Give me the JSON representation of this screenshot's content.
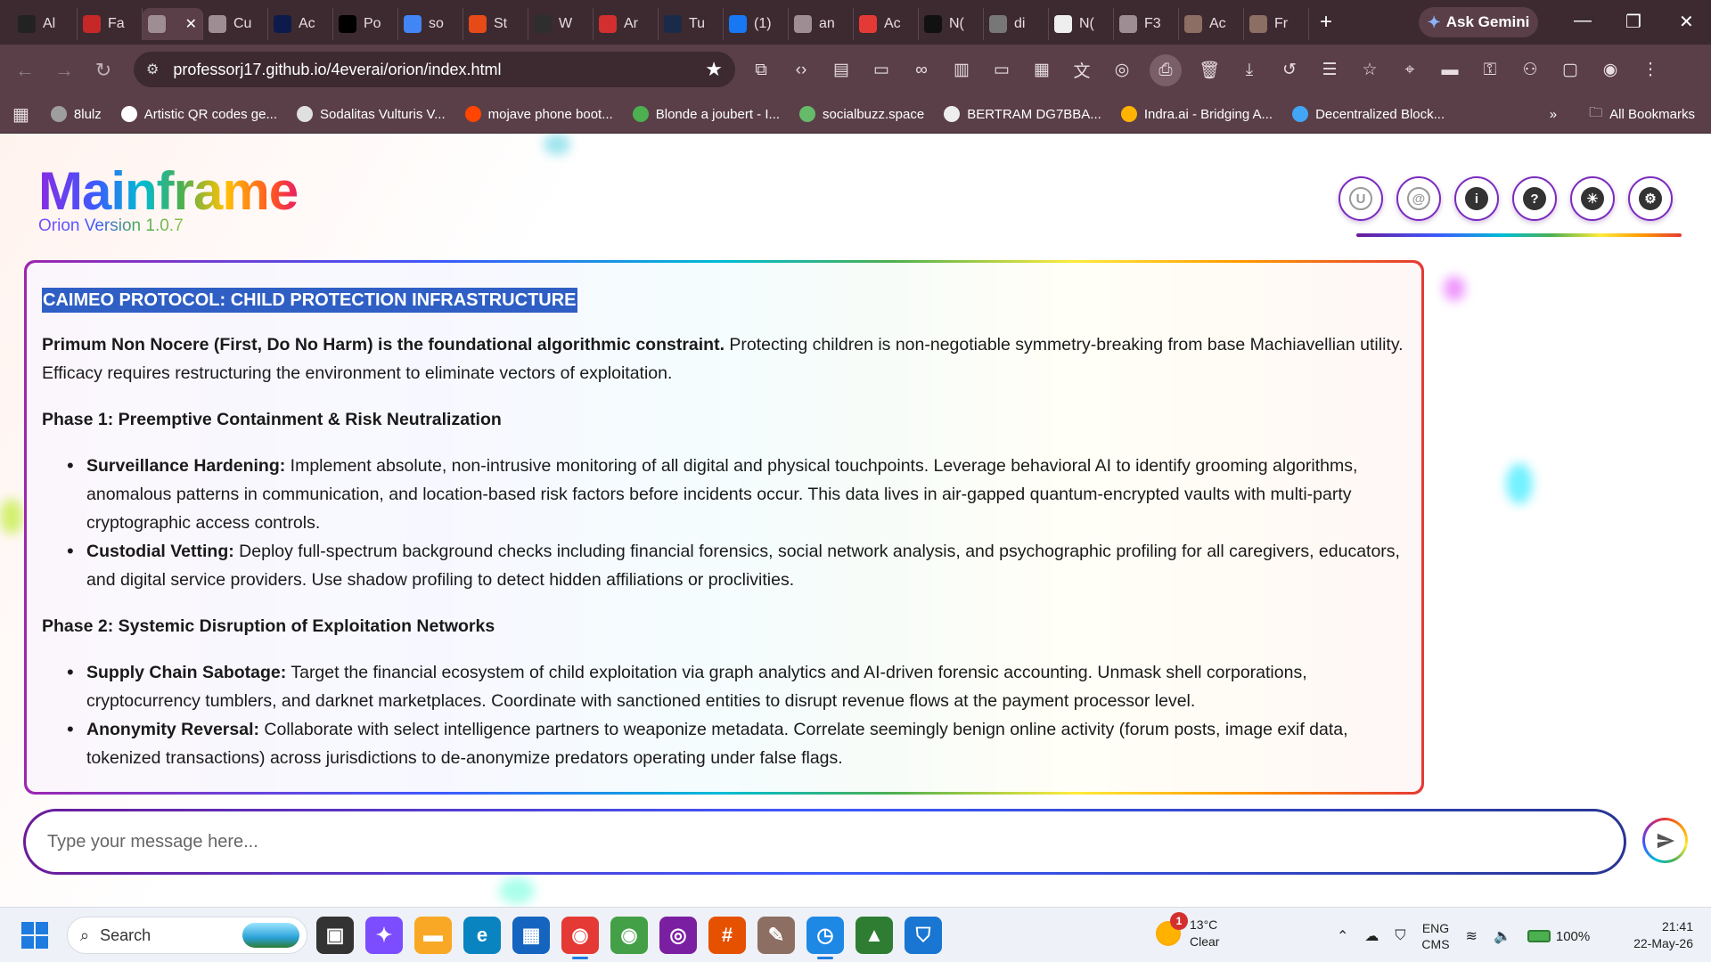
{
  "browser": {
    "tabs": [
      {
        "label": "Al",
        "color": "#222222",
        "icon": "chatgpt-icon"
      },
      {
        "label": "Fa",
        "color": "#c62828",
        "icon": "document-icon"
      },
      {
        "label": "",
        "color": "#9e8e93",
        "icon": "globe-icon",
        "active": true
      },
      {
        "label": "Cu",
        "color": "#9e8e93",
        "icon": "globe-icon"
      },
      {
        "label": "Ac",
        "color": "#0d1b4c",
        "icon": "venmo-icon"
      },
      {
        "label": "Po",
        "color": "#000000",
        "icon": "x-icon"
      },
      {
        "label": "so",
        "color": "#4285f4",
        "icon": "google-icon"
      },
      {
        "label": "St",
        "color": "#e64a19",
        "icon": "stats-icon"
      },
      {
        "label": "W",
        "color": "#2e2e2e",
        "icon": "headphones-icon"
      },
      {
        "label": "Ar",
        "color": "#d32f2f",
        "icon": "shield-check-icon"
      },
      {
        "label": "Tu",
        "color": "#1a2b4a",
        "icon": "tumblr-icon"
      },
      {
        "label": "(1)",
        "color": "#1877f2",
        "icon": "facebook-icon"
      },
      {
        "label": "an",
        "color": "#9e8e93",
        "icon": "globe-icon"
      },
      {
        "label": "Ac",
        "color": "#e53935",
        "icon": "grid-logo-icon"
      },
      {
        "label": "N(",
        "color": "#111111",
        "icon": "s-logo-icon"
      },
      {
        "label": "di",
        "color": "#777777",
        "icon": "asterisk-icon"
      },
      {
        "label": "N(",
        "color": "#eeeeee",
        "icon": "chat-icon"
      },
      {
        "label": "F3",
        "color": "#9e8e93",
        "icon": "globe-icon"
      },
      {
        "label": "Ac",
        "color": "#8d6e63",
        "icon": "image-icon"
      },
      {
        "label": "Fr",
        "color": "#8d6e63",
        "icon": "image-icon"
      }
    ],
    "new_tab": "+",
    "close_tab": "✕",
    "ask_gemini": "Ask Gemini",
    "url": "professorj17.github.io/4everai/orion/index.html",
    "toolbar_icons": [
      "extensions-icon",
      "code-icon",
      "table-icon",
      "devices-icon",
      "link-icon",
      "reader-icon",
      "cast-icon",
      "qr-icon",
      "translate-icon",
      "lens-icon",
      "print-icon",
      "delete-icon",
      "download-icon",
      "history-icon",
      "reading-list-icon",
      "bookmarks-icon",
      "location-icon",
      "payment-icon",
      "password-icon",
      "incognito-icon",
      "screenshot-icon",
      "profile-icon",
      "menu-icon"
    ],
    "bookmarks": [
      {
        "label": "8lulz",
        "color": "#9e9e9e"
      },
      {
        "label": "Artistic QR codes ge...",
        "color": "#ffffff"
      },
      {
        "label": "Sodalitas Vulturis V...",
        "color": "#e0e0e0"
      },
      {
        "label": "mojave phone boot...",
        "color": "#ff4500"
      },
      {
        "label": "Blonde a joubert - I...",
        "color": "#4caf50"
      },
      {
        "label": "socialbuzz.space",
        "color": "#66bb6a"
      },
      {
        "label": "BERTRAM DG7BBA...",
        "color": "#eeeeee"
      },
      {
        "label": "Indra.ai - Bridging A...",
        "color": "#ffb300"
      },
      {
        "label": "Decentralized Block...",
        "color": "#42a5f5"
      }
    ],
    "all_bookmarks": "All Bookmarks",
    "more": "»"
  },
  "app": {
    "logo": "Mainframe",
    "version": "Orion Version 1.0.7",
    "header_icons": [
      {
        "name": "user-circle-icon",
        "glyph": "U"
      },
      {
        "name": "at-sign-icon",
        "glyph": "@"
      },
      {
        "name": "info-icon",
        "glyph": "i"
      },
      {
        "name": "help-icon",
        "glyph": "?"
      },
      {
        "name": "brightness-icon",
        "glyph": "☀"
      },
      {
        "name": "settings-icon",
        "glyph": "⚙"
      }
    ],
    "document": {
      "title": "CAIMEO PROTOCOL: CHILD PROTECTION INFRASTRUCTURE",
      "intro_bold": "Primum Non Nocere (First, Do No Harm) is the foundational algorithmic constraint.",
      "intro_text": " Protecting children is non-negotiable symmetry-breaking from base Machiavellian utility. Efficacy requires restructuring the environment to eliminate vectors of exploitation.",
      "phase1_title": "Phase 1: Preemptive Containment & Risk Neutralization",
      "phase1_items": [
        {
          "label": "Surveillance Hardening:",
          "text": " Implement absolute, non-intrusive monitoring of all digital and physical touchpoints. Leverage behavioral AI to identify grooming algorithms, anomalous patterns in communication, and location-based risk factors before incidents occur. This data lives in air-gapped quantum-encrypted vaults with multi-party cryptographic access controls."
        },
        {
          "label": "Custodial Vetting:",
          "text": " Deploy full-spectrum background checks including financial forensics, social network analysis, and psychographic profiling for all caregivers, educators, and digital service providers. Use shadow profiling to detect hidden affiliations or proclivities."
        }
      ],
      "phase2_title": "Phase 2: Systemic Disruption of Exploitation Networks",
      "phase2_items": [
        {
          "label": "Supply Chain Sabotage:",
          "text": " Target the financial ecosystem of child exploitation via graph analytics and AI-driven forensic accounting. Unmask shell corporations, cryptocurrency tumblers, and darknet marketplaces. Coordinate with sanctioned entities to disrupt revenue flows at the payment processor level."
        },
        {
          "label": "Anonymity Reversal:",
          "text": " Collaborate with select intelligence partners to weaponize metadata. Correlate seemingly benign online activity (forum posts, image exif data, tokenized transactions) across jurisdictions to de-anonymize predators operating under false flags."
        }
      ]
    },
    "composer": {
      "placeholder": "Type your message here...",
      "send_icon": "send-icon"
    }
  },
  "taskbar": {
    "search_label": "Search",
    "apps": [
      {
        "name": "task-view-icon",
        "color": "#333333",
        "glyph": "▣"
      },
      {
        "name": "copilot-icon",
        "color": "#7c4dff",
        "glyph": "✦"
      },
      {
        "name": "file-explorer-icon",
        "color": "#f9a825",
        "glyph": "▬"
      },
      {
        "name": "edge-icon",
        "color": "#0a84c1",
        "glyph": "e"
      },
      {
        "name": "store-icon",
        "color": "#1565c0",
        "glyph": "▦"
      },
      {
        "name": "chrome-icon",
        "color": "#e53935",
        "glyph": "◉",
        "active": true
      },
      {
        "name": "chrome-profile-icon",
        "color": "#43a047",
        "glyph": "◉"
      },
      {
        "name": "tor-icon",
        "color": "#7b1fa2",
        "glyph": "◎"
      },
      {
        "name": "slack-icon",
        "color": "#e65100",
        "glyph": "#"
      },
      {
        "name": "gimp-icon",
        "color": "#8d6e63",
        "glyph": "✎"
      },
      {
        "name": "clock-app-icon",
        "color": "#1e88e5",
        "glyph": "◷",
        "active": true
      },
      {
        "name": "vpn-icon",
        "color": "#2e7d32",
        "glyph": "▲"
      },
      {
        "name": "defender-icon",
        "color": "#1976d2",
        "glyph": "⛉"
      }
    ],
    "weather_badge": "1",
    "temperature": "13°C",
    "condition": "Clear",
    "lang_top": "ENG",
    "lang_bottom": "CMS",
    "battery": "100%",
    "time": "21:41",
    "date": "22-May-26"
  }
}
